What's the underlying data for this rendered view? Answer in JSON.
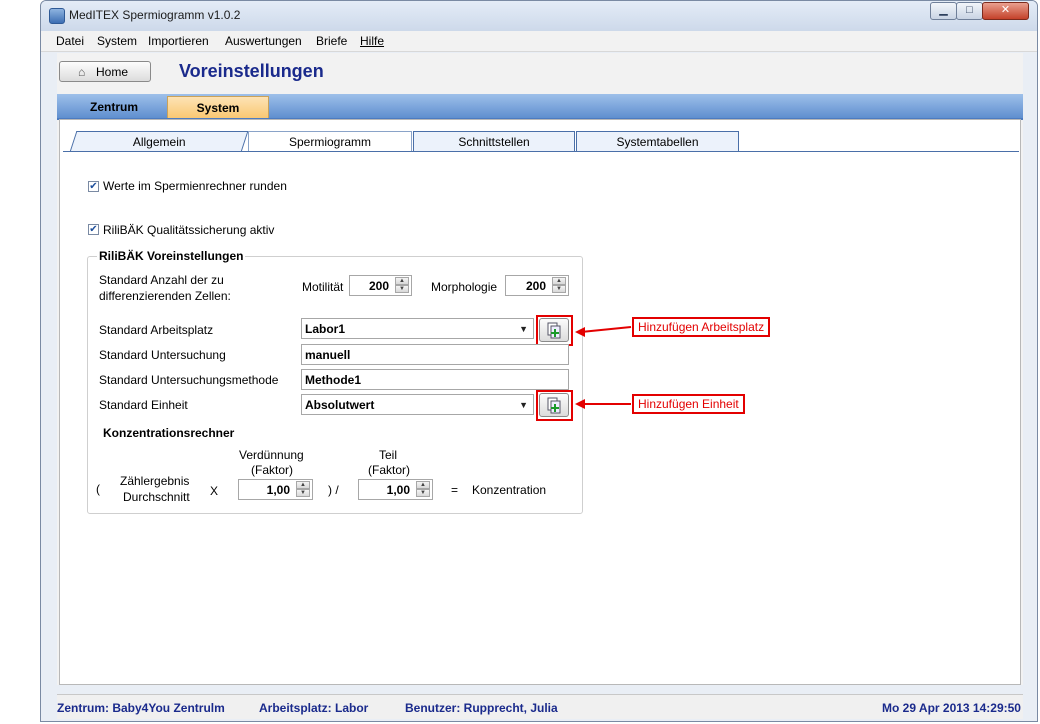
{
  "window": {
    "title": "MedITEX Spermiogramm v1.0.2",
    "controls": {
      "minimize": "▁",
      "maximize": "□",
      "close": "✕"
    }
  },
  "menu": [
    "Datei",
    "System",
    "Importieren",
    "Auswertungen",
    "Briefe",
    "Hilfe"
  ],
  "header": {
    "home_label": "Home",
    "page_title": "Voreinstellungen"
  },
  "main_tabs": [
    {
      "label": "Zentrum",
      "active": false
    },
    {
      "label": "System",
      "active": true
    }
  ],
  "sub_tabs": [
    {
      "label": "Allgemein",
      "active": false
    },
    {
      "label": "Spermiogramm",
      "active": true
    },
    {
      "label": "Schnittstellen",
      "active": false
    },
    {
      "label": "Systemtabellen",
      "active": false
    }
  ],
  "options": {
    "round_values": {
      "label": "Werte im Spermienrechner runden",
      "checked": true
    },
    "rilibaek_active": {
      "label": "RiliBÄK Qualitätssicherung aktiv",
      "checked": true
    }
  },
  "rilibaek": {
    "group_title": "RiliBÄK Voreinstellungen",
    "cells_label_1": "Standard Anzahl der zu",
    "cells_label_2": "differenzierenden Zellen:",
    "motility_label": "Motilität",
    "motility_value": "200",
    "morphology_label": "Morphologie",
    "morphology_value": "200",
    "workplace_label": "Standard Arbeitsplatz",
    "workplace_value": "Labor1",
    "exam_label": "Standard Untersuchung",
    "exam_value": "manuell",
    "method_label": "Standard Untersuchungsmethode",
    "method_value": "Methode1",
    "unit_label": "Standard Einheit",
    "unit_value": "Absolutwert"
  },
  "calculator": {
    "title": "Konzentrationsrechner",
    "open_paren": "(",
    "count_label_1": "Zählergebnis",
    "count_label_2": "Durchschnitt",
    "times": "X",
    "dilution_label_1": "Verdünnung",
    "dilution_label_2": "(Faktor)",
    "dilution_value": "1,00",
    "close_paren_div": ") /",
    "part_label_1": "Teil",
    "part_label_2": "(Faktor)",
    "part_value": "1,00",
    "equals": "=",
    "result_label": "Konzentration"
  },
  "annotations": {
    "add_workplace": "Hinzufügen Arbeitsplatz",
    "add_unit": "Hinzufügen Einheit"
  },
  "statusbar": {
    "center": "Zentrum: Baby4You Zentrulm",
    "workplace": "Arbeitsplatz: Labor",
    "user": "Benutzer: Rupprecht, Julia",
    "datetime": "Mo 29 Apr 2013 14:29:50"
  },
  "colors": {
    "accent_title": "#1a2a8c",
    "annotation_red": "#e30000",
    "active_tab": "#f9c873"
  }
}
